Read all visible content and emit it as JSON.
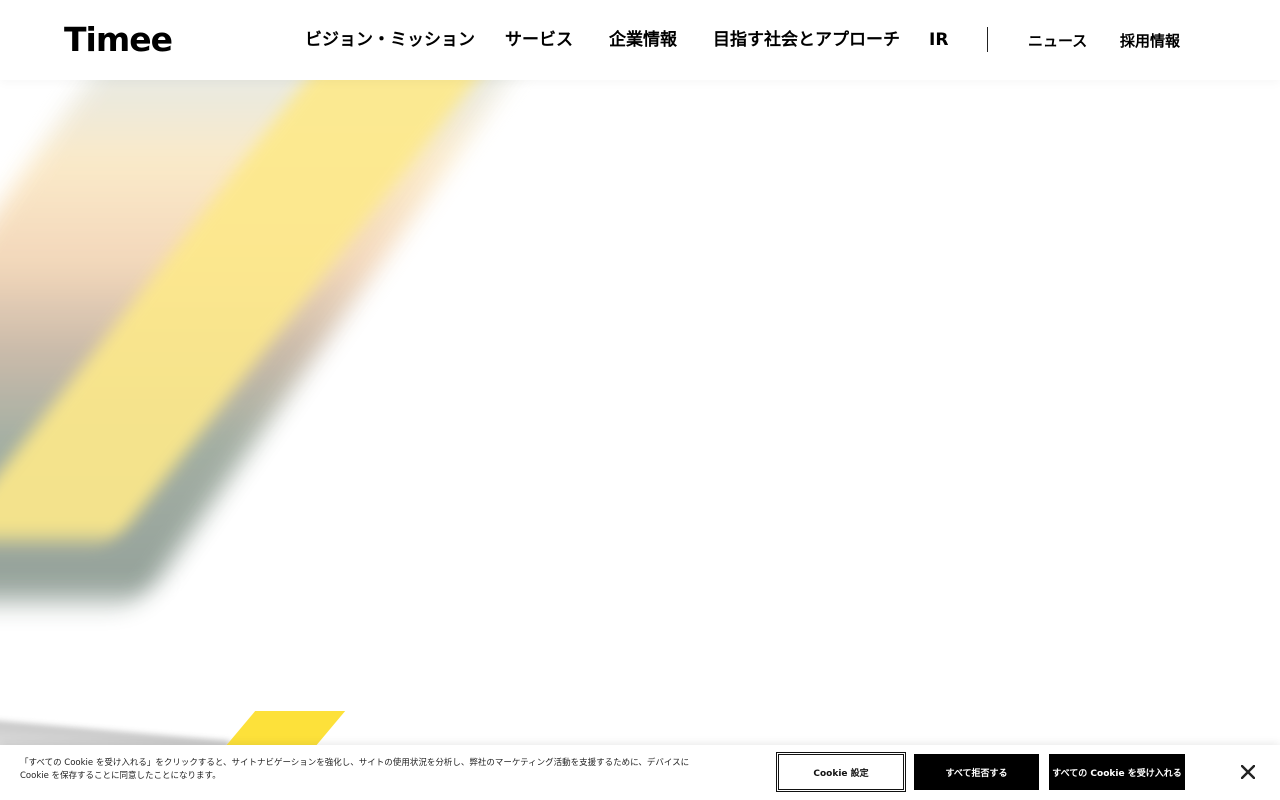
{
  "header": {
    "logo": "Timee",
    "nav": [
      {
        "label": "ビジョン・ミッション"
      },
      {
        "label": "サービス"
      },
      {
        "label": "企業情報"
      },
      {
        "label": "目指す社会とアプローチ"
      },
      {
        "label": "IR"
      }
    ],
    "sub_nav": [
      {
        "label": "ニュース"
      },
      {
        "label": "採用情報"
      }
    ]
  },
  "cookie_banner": {
    "text": "「すべての Cookie を受け入れる」をクリックすると、サイトナビゲーションを強化し、サイトの使用状況を分析し、弊社のマーケティング活動を支援するために、デバイスに Cookie を保存することに同意したことになります。",
    "settings_label": "Cookie 設定",
    "reject_label": "すべて拒否する",
    "accept_label": "すべての Cookie を受け入れる"
  },
  "colors": {
    "accent_yellow": "#fde13a",
    "text": "#000000",
    "background": "#ffffff"
  },
  "icons": {
    "close": "close-icon"
  }
}
